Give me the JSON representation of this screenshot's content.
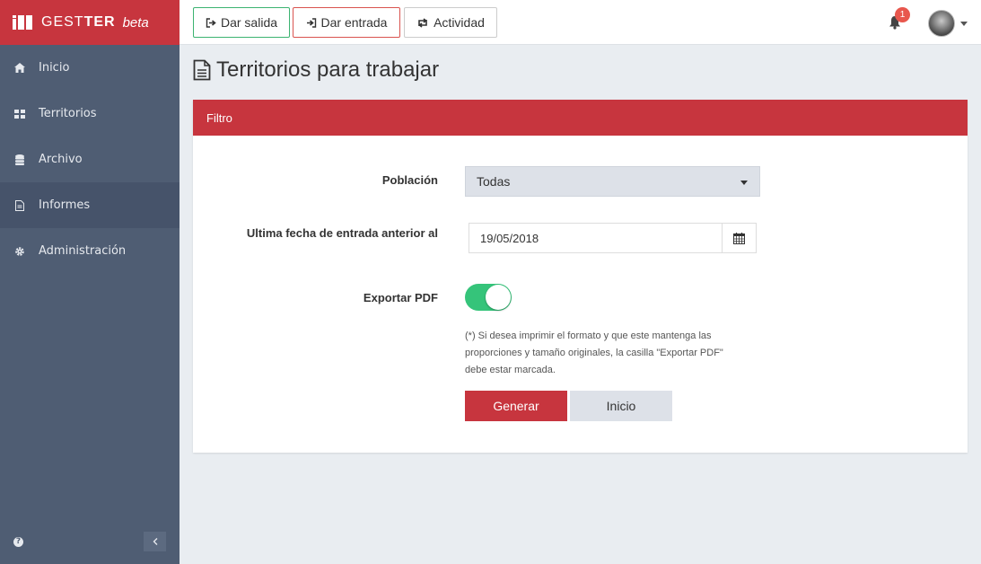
{
  "brand": {
    "name_light": "GEST",
    "name_bold": "TER",
    "suffix": "beta"
  },
  "sidebar": {
    "items": [
      {
        "label": "Inicio",
        "icon": "home-icon"
      },
      {
        "label": "Territorios",
        "icon": "grid-icon"
      },
      {
        "label": "Archivo",
        "icon": "database-icon"
      },
      {
        "label": "Informes",
        "icon": "file-icon"
      },
      {
        "label": "Administración",
        "icon": "gear-icon"
      }
    ],
    "active_index": 3
  },
  "topbar": {
    "salida_label": "Dar salida",
    "entrada_label": "Dar entrada",
    "actividad_label": "Actividad",
    "notification_count": "1"
  },
  "page": {
    "title": "Territorios para trabajar"
  },
  "panel": {
    "heading": "Filtro",
    "poblacion_label": "Población",
    "poblacion_value": "Todas",
    "fecha_label": "Ultima fecha de entrada anterior al",
    "fecha_value": "19/05/2018",
    "pdf_label": "Exportar PDF",
    "pdf_enabled": true,
    "note_line1": "(*) Si desea imprimir el formato y que este mantenga las",
    "note_line2": "proporciones y tamaño originales, la casilla \"Exportar PDF\"",
    "note_line3": "debe estar marcada.",
    "generar_label": "Generar",
    "inicio_label": "Inicio"
  },
  "colors": {
    "brand_red": "#c7353e",
    "sidebar": "#4f5d73",
    "toggle_green": "#35c47a"
  }
}
